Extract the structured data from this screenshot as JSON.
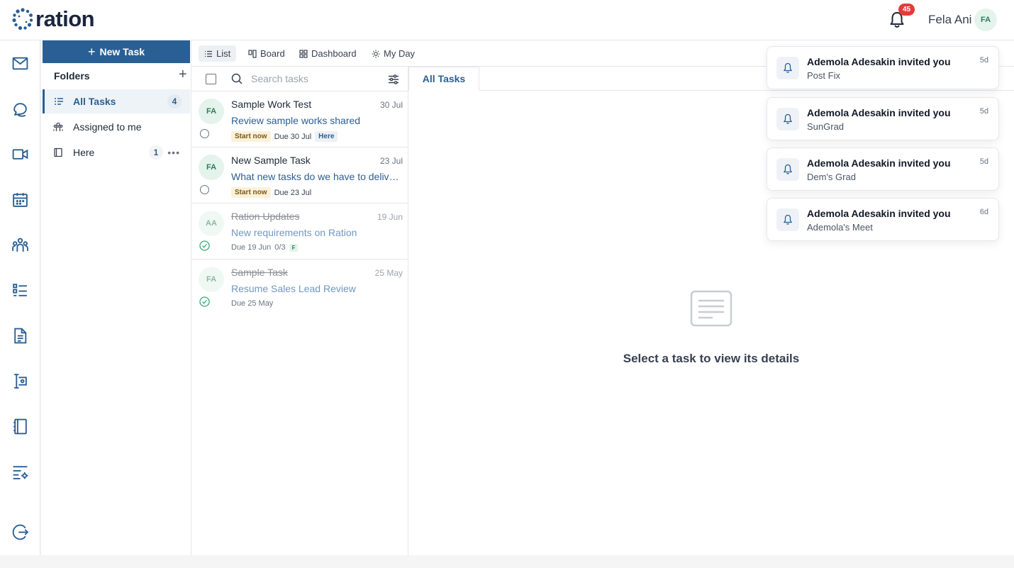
{
  "app": {
    "logo_text": "ration"
  },
  "header": {
    "notification_count": "45",
    "user_name": "Fela Ani",
    "user_initials": "FA"
  },
  "rail": {
    "icons": [
      "mail-icon",
      "chat-icon",
      "video-icon",
      "calendar-icon",
      "team-icon",
      "tasks-icon",
      "document-icon",
      "form-icon",
      "notebook-icon",
      "settings-list-icon",
      "logout-icon"
    ]
  },
  "sidebar": {
    "new_task_label": "New Task",
    "folders_title": "Folders",
    "items": [
      {
        "label": "All Tasks",
        "count": "4",
        "icon": "list-icon"
      },
      {
        "label": "Assigned to me",
        "icon": "people-icon"
      },
      {
        "label": "Here",
        "count": "1",
        "icon": "folder-icon"
      }
    ]
  },
  "views": {
    "tabs": [
      {
        "label": "List",
        "icon": "list-view-icon"
      },
      {
        "label": "Board",
        "icon": "board-icon"
      },
      {
        "label": "Dashboard",
        "icon": "dashboard-icon"
      },
      {
        "label": "My Day",
        "icon": "sun-icon"
      }
    ]
  },
  "search": {
    "placeholder": "Search tasks"
  },
  "tasks": [
    {
      "initials": "FA",
      "title": "Sample Work Test",
      "date": "30 Jul",
      "desc": "Review sample works shared",
      "start": "Start now",
      "due": "Due 30 Jul",
      "folder": "Here"
    },
    {
      "initials": "FA",
      "title": "New Sample Task",
      "date": "23 Jul",
      "desc": "What new tasks do we have to deliver this week",
      "start": "Start now",
      "due": "Due 23 Jul"
    },
    {
      "initials": "AA",
      "title": "Ration Updates",
      "date": "19 Jun",
      "desc": "New requirements on Ration",
      "due": "Due 19 Jun",
      "progress": "0/3",
      "tag": "F"
    },
    {
      "initials": "FA",
      "title": "Sample Task",
      "date": "25 May",
      "desc": "Resume Sales Lead Review",
      "due": "Due 25 May"
    }
  ],
  "detail": {
    "tab_label": "All Tasks",
    "empty_text": "Select a task to view its details"
  },
  "notifications": [
    {
      "title": "Ademola Adesakin invited you",
      "subtitle": "Post Fix",
      "time": "5d"
    },
    {
      "title": "Ademola Adesakin invited you",
      "subtitle": "SunGrad",
      "time": "5d"
    },
    {
      "title": "Ademola Adesakin invited you",
      "subtitle": "Dem's Grad",
      "time": "5d"
    },
    {
      "title": "Ademola Adesakin invited you",
      "subtitle": "Ademola's Meet",
      "time": "6d"
    }
  ],
  "colors": {
    "brand": "#2a5f93",
    "badge": "#e33b3b",
    "avatar_bg": "#e4f3ec",
    "done_check": "#3aa874"
  }
}
